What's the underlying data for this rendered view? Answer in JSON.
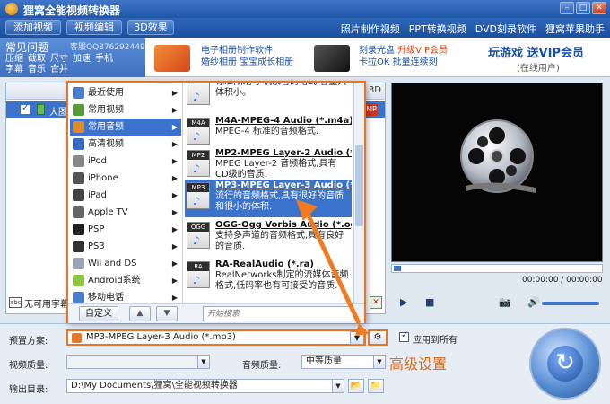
{
  "window": {
    "title": "狸窝全能视频转换器"
  },
  "menu": {
    "buttons": [
      "添加视频",
      "视频编辑",
      "3D效果"
    ],
    "links": [
      "照片制作视频",
      "PPT转换视频",
      "DVD刻录软件",
      "狸窝苹果助手"
    ]
  },
  "faq": {
    "title": "常见问题",
    "qq": "客服QQ876292449",
    "links": [
      "压缩",
      "截取",
      "尺寸",
      "加速",
      "手机",
      "字幕",
      "音乐",
      "合并"
    ]
  },
  "ads": {
    "ad1_line1": "电子相册制作软件",
    "ad1_line2": "婚纱相册 宝宝成长相册",
    "ad2_line1a": "刻录光盘",
    "ad2_line1b": "升级VIP会员",
    "ad2_line2": "卡拉OK 批量连续刻",
    "game": "玩游戏  送VIP会员",
    "game_sub": "(在线用户)"
  },
  "filelist": {
    "header_3d": "3D",
    "file_name": "大图",
    "mp_badge": "MP"
  },
  "subtitle": {
    "label": "无可用字幕"
  },
  "popup": {
    "categories": [
      {
        "label": "最近使用",
        "color": "#4a7fd0"
      },
      {
        "label": "常用视频",
        "color": "#5b9a3c"
      },
      {
        "label": "常用音频",
        "color": "#e08a2a"
      },
      {
        "label": "高清视频",
        "color": "#3a6ac2"
      },
      {
        "label": "iPod",
        "color": "#888888"
      },
      {
        "label": "iPhone",
        "color": "#555555"
      },
      {
        "label": "iPad",
        "color": "#444444"
      },
      {
        "label": "Apple TV",
        "color": "#666666"
      },
      {
        "label": "PSP",
        "color": "#222222"
      },
      {
        "label": "PS3",
        "color": "#333333"
      },
      {
        "label": "Wii and DS",
        "color": "#9aa5b5"
      },
      {
        "label": "Android系统",
        "color": "#8fc640"
      },
      {
        "label": "移动电话",
        "color": "#4a7fd0"
      }
    ],
    "selected_category": "常用音频",
    "formats": [
      {
        "tag": "",
        "title": "",
        "desc": "标准,保存手机录音的格式,容量大体积小。"
      },
      {
        "tag": "M4A",
        "title": "M4A-MPEG-4 Audio (*.m4a)",
        "desc": "MPEG-4 标准的音频格式."
      },
      {
        "tag": "MP2",
        "title": "MP2-MPEG Layer-2 Audio (*.mp2)",
        "desc": "MPEG Layer-2 音频格式,具有CD级的音质."
      },
      {
        "tag": "MP3",
        "title": "MP3-MPEG Layer-3 Audio (*.mp3)",
        "desc": "流行的音频格式,具有很好的音质和很小的体积."
      },
      {
        "tag": "OGG",
        "title": "OGG-Ogg Vorbis Audio (*.ogg)",
        "desc": "支持多声道的音频格式,具有良好的音质."
      },
      {
        "tag": "RA",
        "title": "RA-RealAudio (*.ra)",
        "desc": "RealNetworks制定的流媒体音频格式,低码率也有可接受的音质."
      }
    ],
    "custom_label": "自定义",
    "search_placeholder": "开始搜索"
  },
  "preview": {
    "time": "00:00:00 / 00:00:00"
  },
  "bottom": {
    "preset_label": "预置方案:",
    "preset_value": "MP3-MPEG Layer-3 Audio (*.mp3)",
    "apply_all": "应用到所有",
    "video_quality_label": "视频质量:",
    "audio_quality_label": "音频质量:",
    "audio_quality_value": "中等质量",
    "output_label": "输出目录:",
    "output_path": "D:\\My Documents\\狸窝\\全能视频转换器",
    "adv_label": "高级设置"
  },
  "colors": {
    "accent": "#3b73cc",
    "highlight": "#e8762a",
    "annotation": "#e06a1a"
  }
}
